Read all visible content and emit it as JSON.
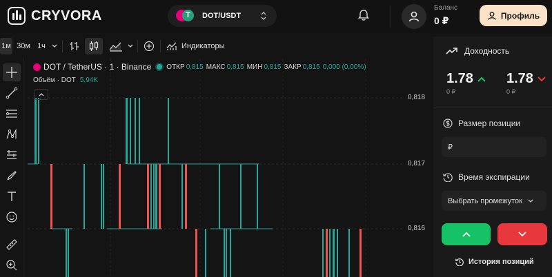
{
  "header": {
    "brand": "CRYVORA",
    "pair_label": "DOT/USDT",
    "balance_label": "Баланс",
    "balance_value": "0 ₽",
    "profile_label": "Профиль"
  },
  "toolbar": {
    "intervals": [
      "1м",
      "30м",
      "1ч"
    ],
    "active_interval": "1м",
    "indicators_label": "Индикаторы"
  },
  "chart": {
    "symbol": "DOT / TetherUS · 1 · Binance",
    "ohlc": {
      "open_label": "ОТКР",
      "open": "0,815",
      "high_label": "МАКС",
      "high": "0,815",
      "low_label": "МИН",
      "low": "0,815",
      "close_label": "ЗАКР",
      "close": "0,815",
      "change": "0,000 (0,00%)"
    },
    "volume_label": "Объём · DOT",
    "volume_value": "5,94K",
    "price_ticks": [
      "0,818",
      "0,817",
      "0,816"
    ]
  },
  "colors": {
    "up": "#26a69a",
    "down": "#ef5350",
    "buy": "#16c266",
    "sell": "#e8383d",
    "profile_bg": "#fbe2c6"
  },
  "panel": {
    "payout_title": "Доходность",
    "payout_up": "1.78",
    "payout_up_currency": "0 ₽",
    "payout_down": "1.78",
    "payout_down_currency": "0 ₽",
    "size_label": "Размер позиции",
    "size_placeholder": "₽",
    "expiry_label": "Время экспирации",
    "expiry_select": "Выбрать промежуток",
    "history_label": "История позиций"
  }
}
